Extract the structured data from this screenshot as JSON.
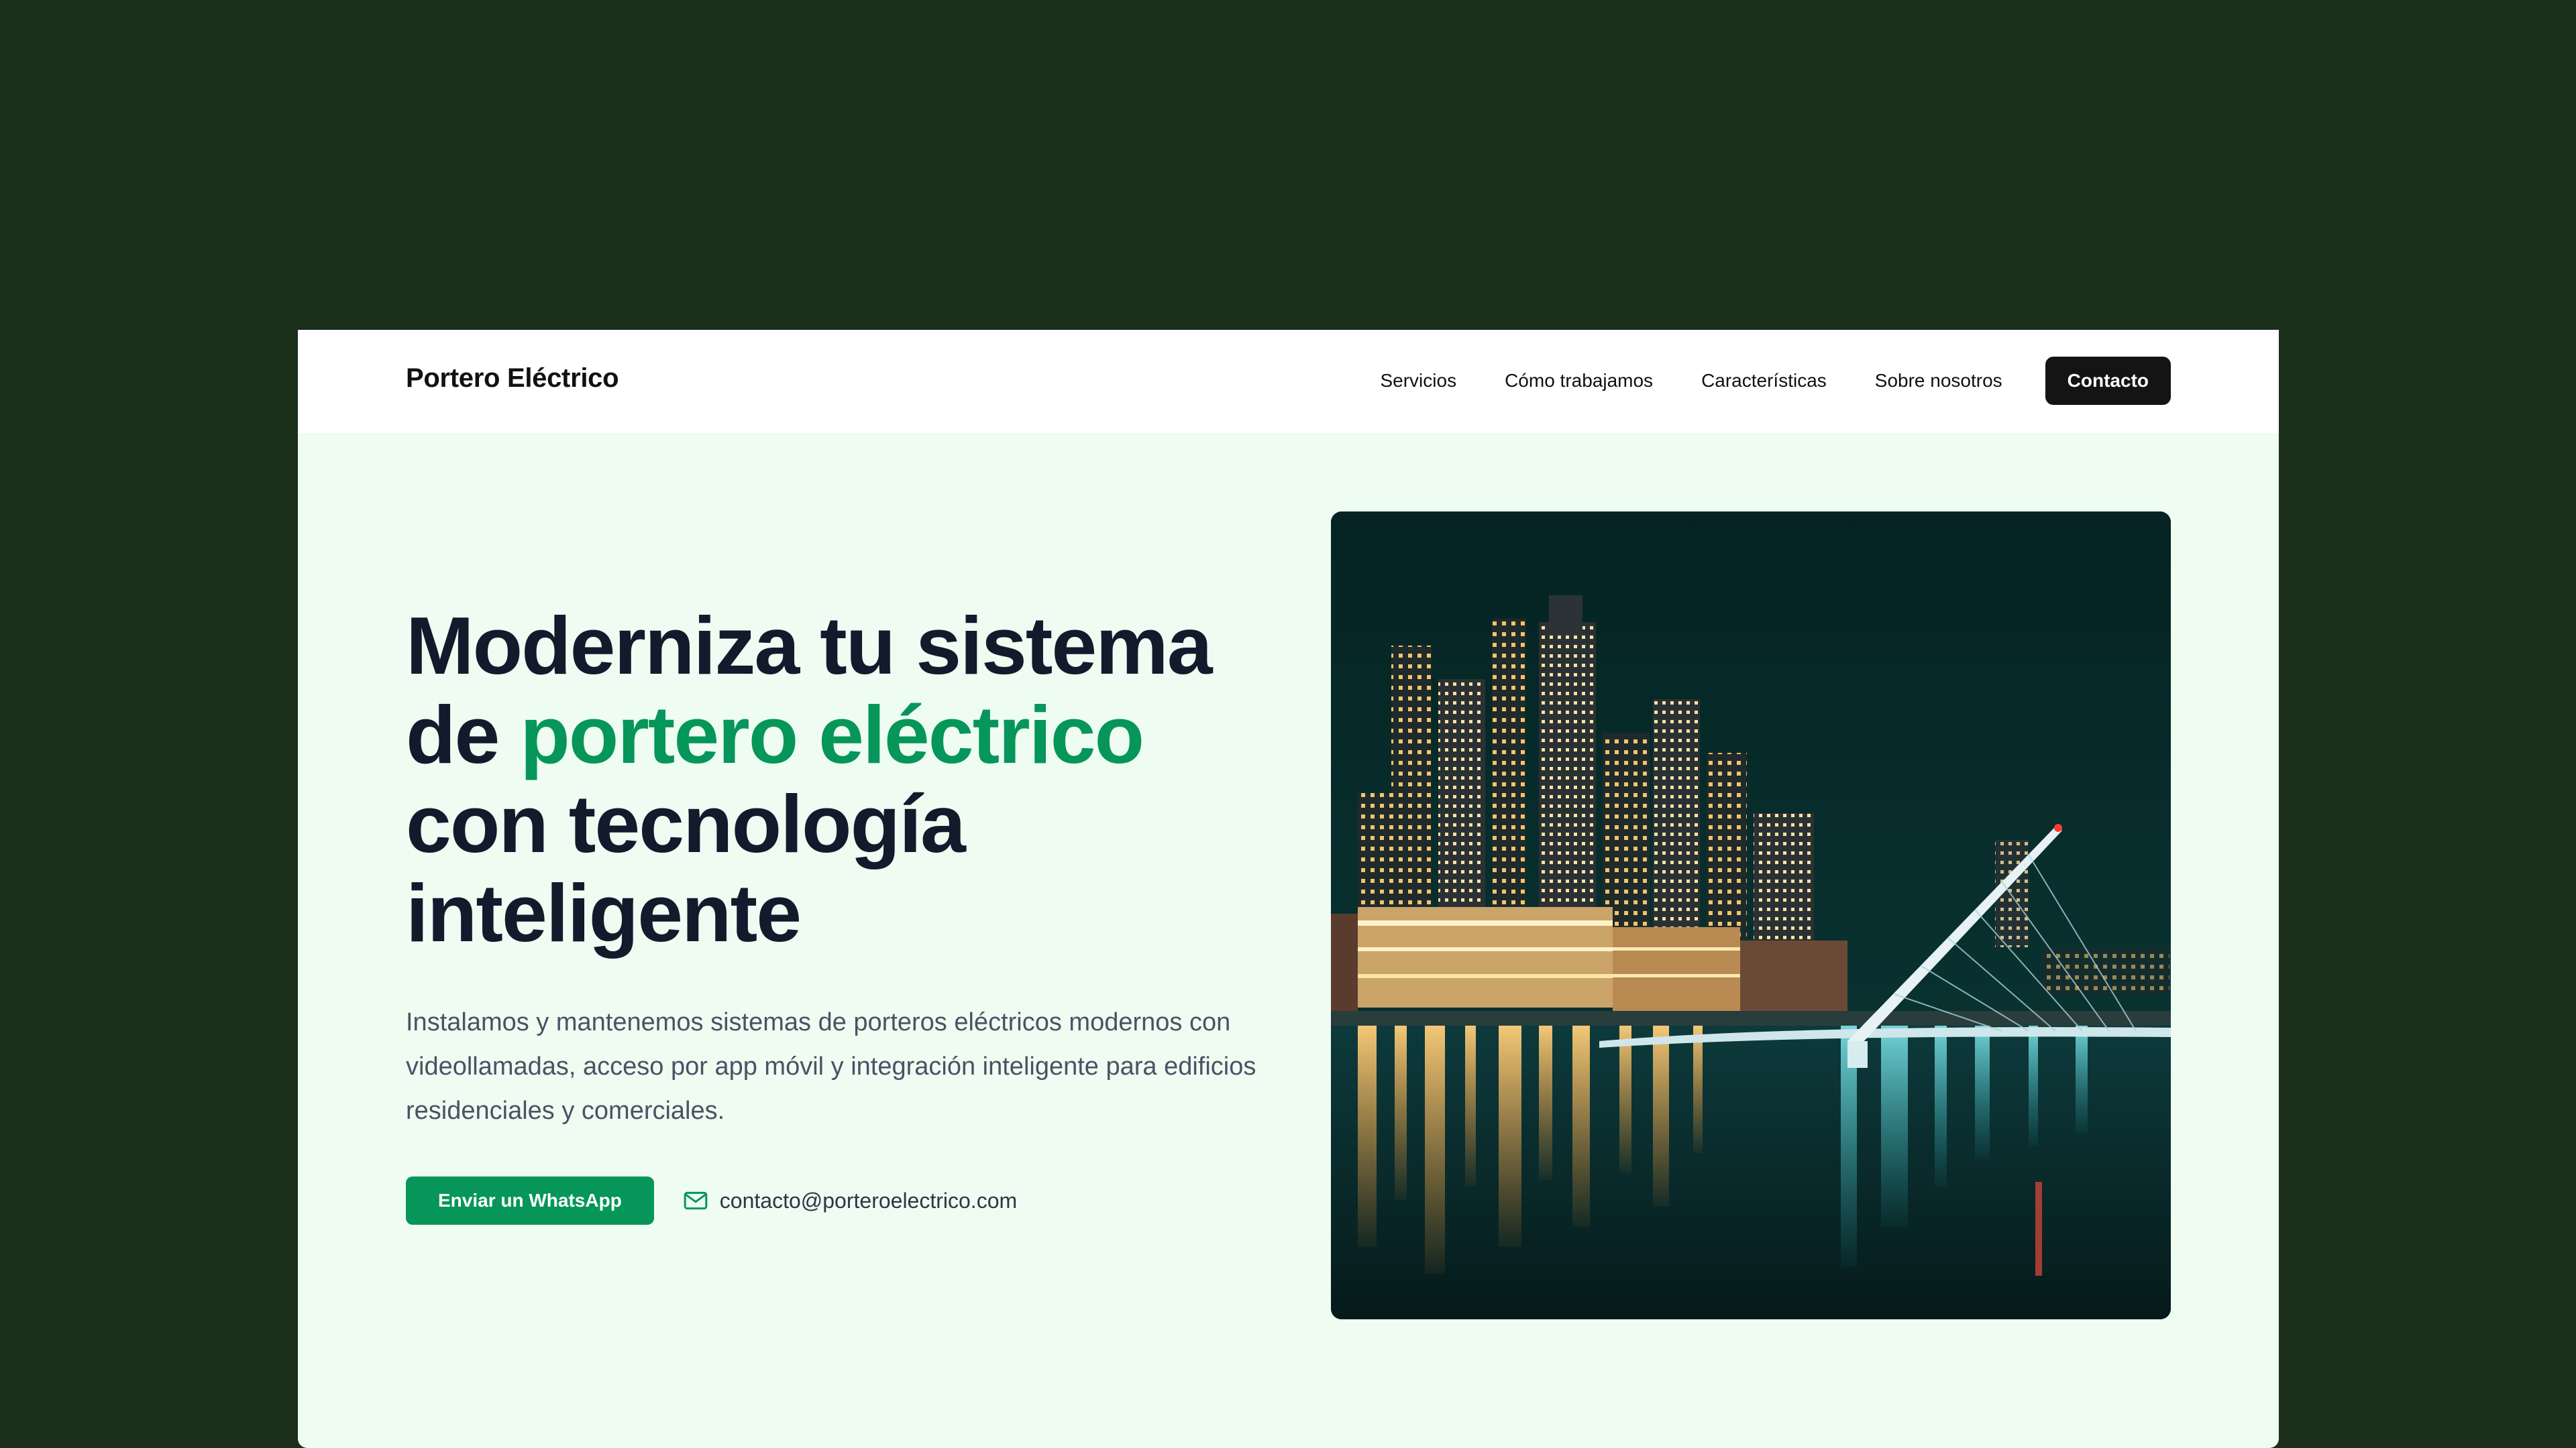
{
  "header": {
    "brand": "Portero Eléctrico",
    "nav": [
      {
        "label": "Servicios"
      },
      {
        "label": "Cómo trabajamos"
      },
      {
        "label": "Características"
      },
      {
        "label": "Sobre nosotros"
      }
    ],
    "cta_label": "Contacto"
  },
  "hero": {
    "title_part1": "Moderniza tu sistema de ",
    "title_accent": "portero eléctrico",
    "title_part2": " con tecnología inteligente",
    "description": "Instalamos y mantenemos sistemas de porteros eléctricos modernos con videollamadas, acceso por app móvil y integración inteligente para edificios residenciales y comerciales.",
    "whatsapp_label": "Enviar un WhatsApp",
    "email": "contacto@porteroelectrico.com",
    "image_icon": "night-city-bridge-photo"
  },
  "colors": {
    "page_background": "#1a2e1a",
    "hero_background": "#eefcf2",
    "accent": "#07965a",
    "heading": "#121a2c",
    "cta_dark": "#141414"
  }
}
